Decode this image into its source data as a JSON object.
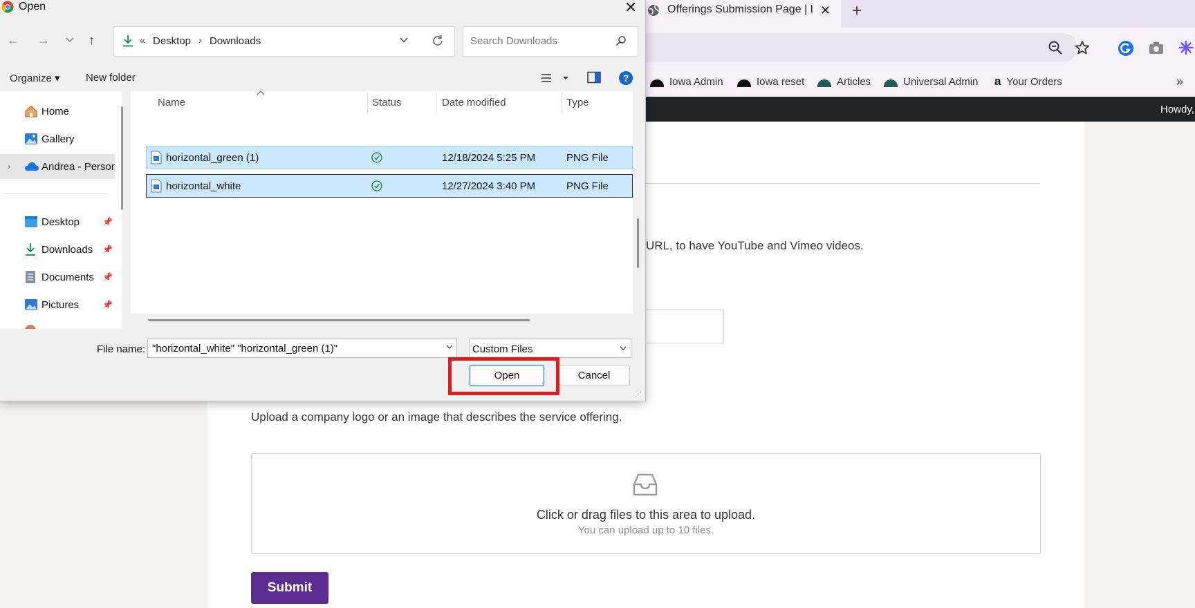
{
  "browser": {
    "tab_title": "Offerings Submission Page | Lo",
    "new_tab_label": "+",
    "bookmarks": [
      {
        "label": "Iowa Admin",
        "icon": "black-dome-icon"
      },
      {
        "label": "Iowa reset",
        "icon": "black-dome-icon"
      },
      {
        "label": "Articles",
        "icon": "teal-dome-icon"
      },
      {
        "label": "Universal Admin",
        "icon": "teal-dome-icon"
      },
      {
        "label": "Your Orders",
        "icon": "amazon-icon"
      }
    ],
    "bookmark_overflow": "»",
    "admin_greeting": "Howdy,",
    "colors": {
      "tab_strip": "#e9dff0",
      "toolbar": "#f7f0f9",
      "admin_bar": "#1d2327"
    }
  },
  "page": {
    "video_help": "URL, to have YouTube and Vimeo videos.",
    "upload_help": "Upload a company logo or an image that describes the service offering.",
    "dropzone_text": "Click or drag files to this area to upload.",
    "dropzone_hint": "You can upload up to 10 files.",
    "submit_label": "Submit",
    "submit_color": "#5c2d91"
  },
  "dialog": {
    "title": "Open",
    "address": {
      "chevron": "«",
      "crumbs": [
        "Desktop",
        "Downloads"
      ],
      "separator": "›"
    },
    "search_placeholder": "Search Downloads",
    "organize_label": "Organize ▾",
    "new_folder_label": "New folder",
    "nav_items": [
      {
        "label": "Home",
        "icon": "home-icon",
        "pinned": false
      },
      {
        "label": "Gallery",
        "icon": "gallery-icon",
        "pinned": false
      },
      {
        "label": "Andrea - Personal",
        "icon": "onedrive-icon",
        "pinned": false
      },
      {
        "label": "Desktop",
        "icon": "desktop-icon",
        "pinned": true
      },
      {
        "label": "Downloads",
        "icon": "downloads-icon",
        "pinned": true
      },
      {
        "label": "Documents",
        "icon": "documents-icon",
        "pinned": true
      },
      {
        "label": "Pictures",
        "icon": "pictures-icon",
        "pinned": true
      }
    ],
    "columns": [
      "Name",
      "Status",
      "Date modified",
      "Type"
    ],
    "files": [
      {
        "name": "horizontal_green (1)",
        "status": "synced",
        "date": "12/18/2024 5:25 PM",
        "type": "PNG File",
        "selected": true
      },
      {
        "name": "horizontal_white",
        "status": "synced",
        "date": "12/27/2024 3:40 PM",
        "type": "PNG File",
        "selected": true
      }
    ],
    "file_name_label": "File name:",
    "file_name_value": "\"horizontal_white\" \"horizontal_green (1)\"",
    "file_type_value": "Custom Files",
    "open_label": "Open",
    "cancel_label": "Cancel",
    "highlight_color": "#e01b1b"
  }
}
